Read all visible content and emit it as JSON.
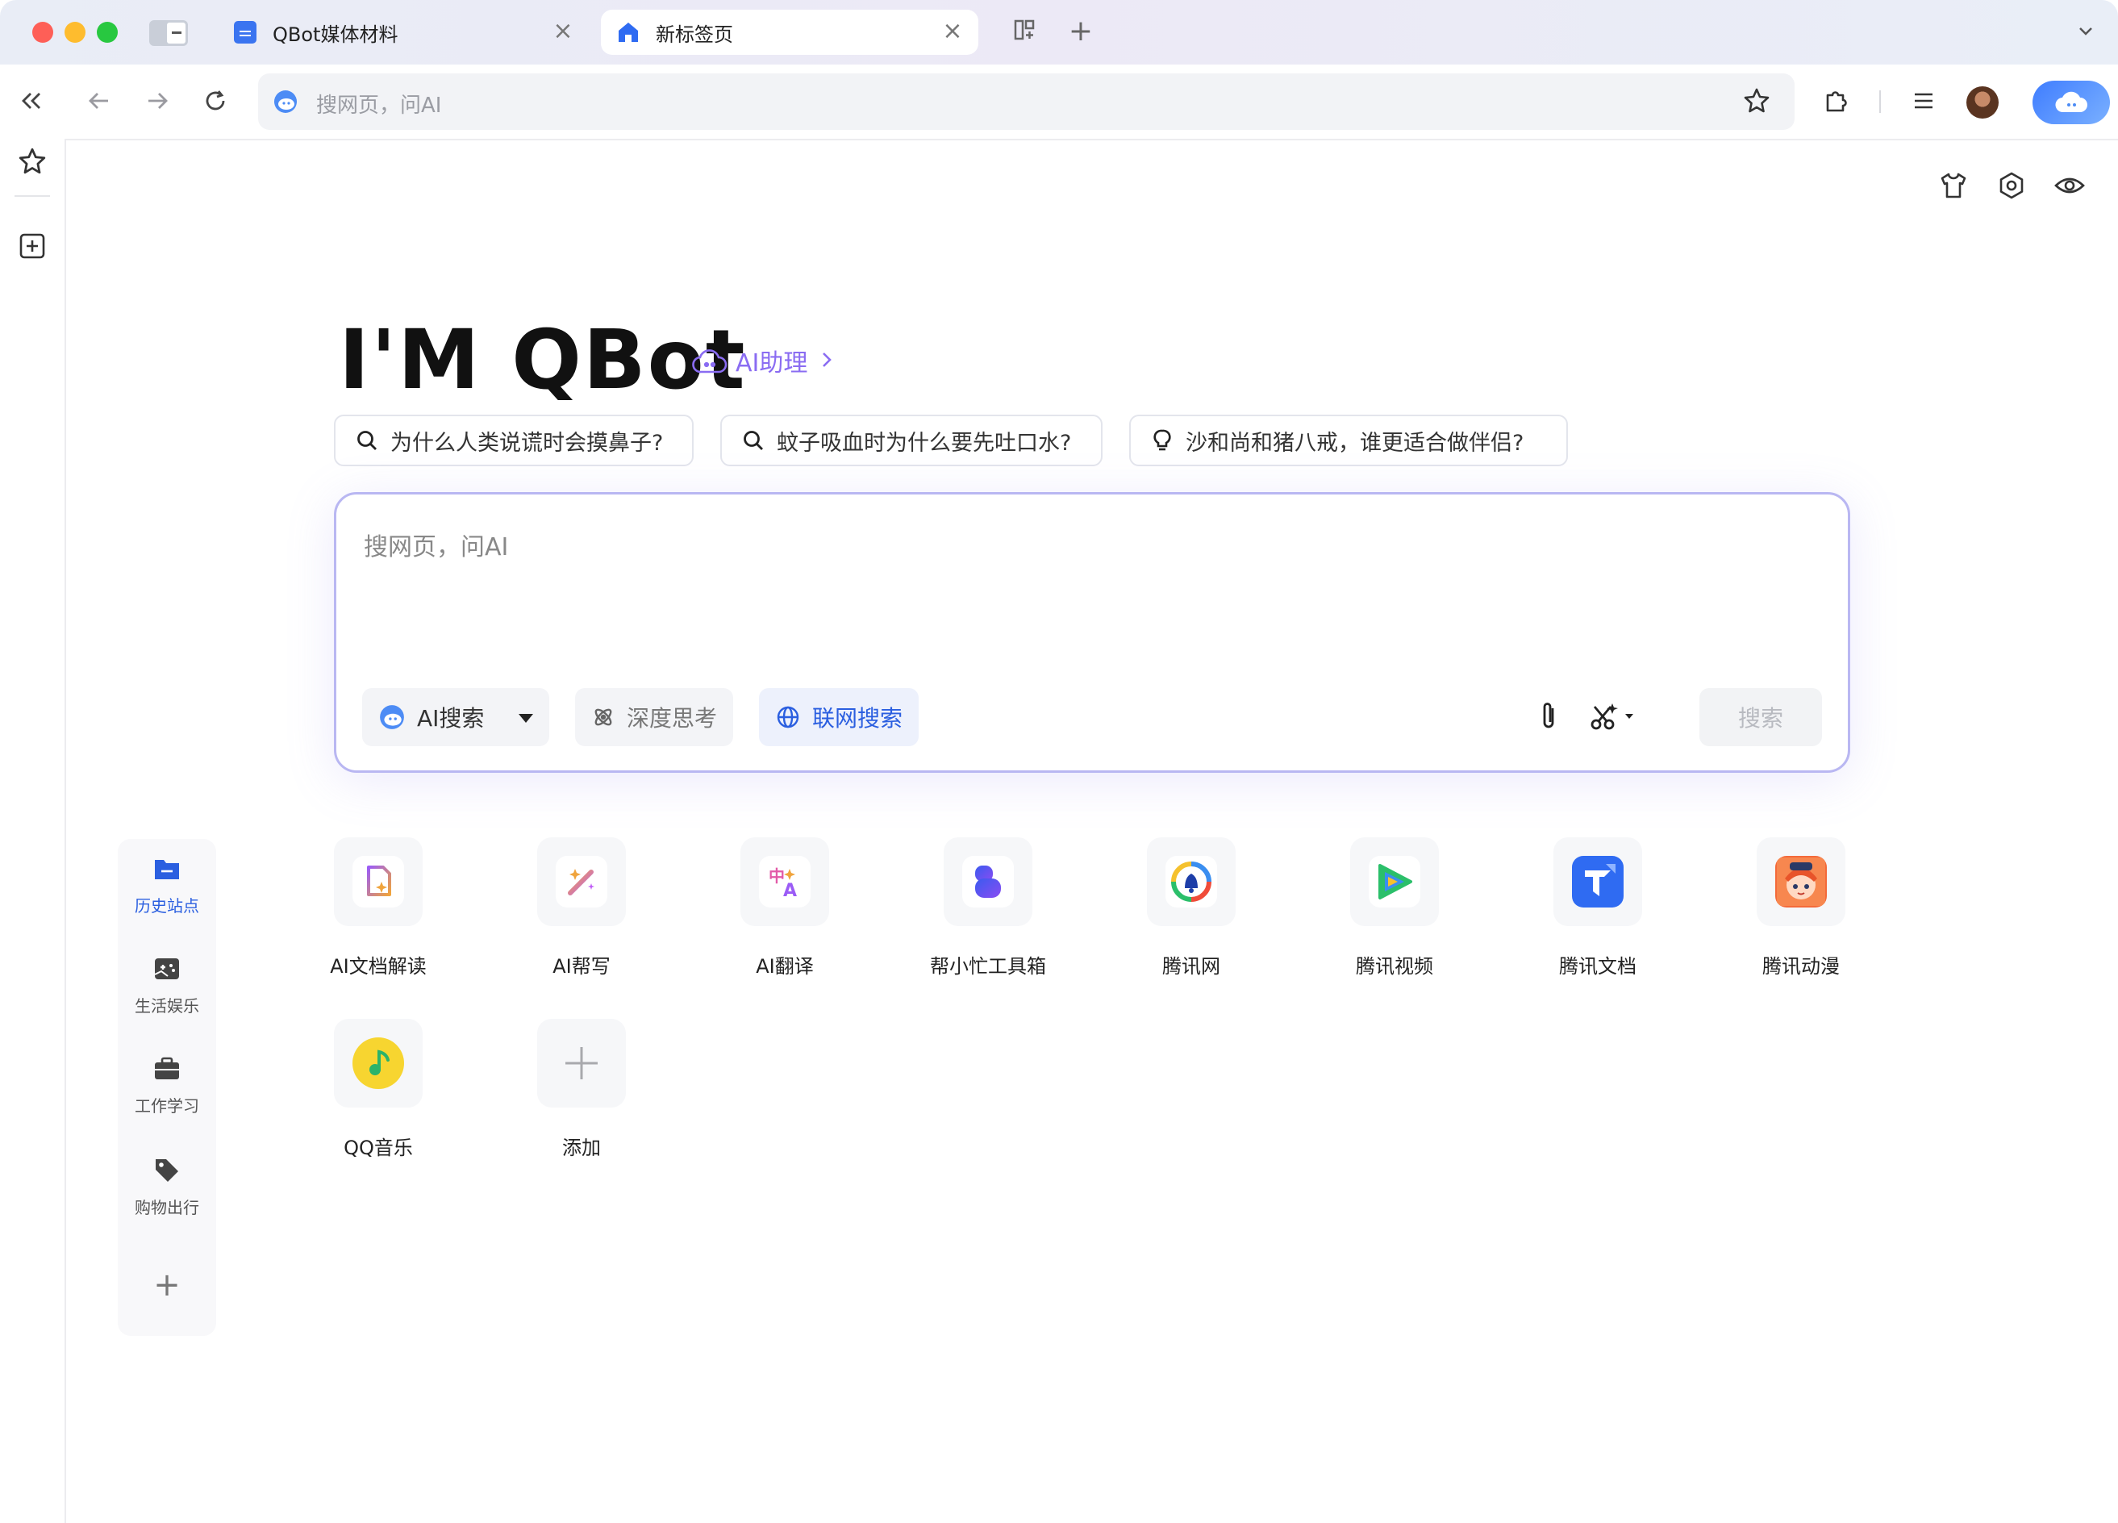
{
  "tabs": [
    {
      "label": "QBot媒体材料",
      "icon": "doc-icon",
      "active": false
    },
    {
      "label": "新标签页",
      "icon": "home-icon",
      "active": true
    }
  ],
  "omnibox": {
    "placeholder": "搜网页，问AI"
  },
  "hero": {
    "title": "I'M QBot",
    "assist_label": "AI助理"
  },
  "suggestions": [
    {
      "text": "为什么人类说谎时会摸鼻子?",
      "icon": "search-icon"
    },
    {
      "text": "蚊子吸血时为什么要先吐口水?",
      "icon": "search-icon"
    },
    {
      "text": "沙和尚和猪八戒，谁更适合做伴侣?",
      "icon": "lightbulb-icon"
    }
  ],
  "search": {
    "placeholder": "搜网页，问AI",
    "mode_label": "AI搜索",
    "deep_label": "深度思考",
    "web_label": "联网搜索",
    "submit_label": "搜索"
  },
  "categories": [
    {
      "label": "历史站点",
      "icon": "folder-icon",
      "active": true
    },
    {
      "label": "生活娱乐",
      "icon": "gamepad-icon",
      "active": false
    },
    {
      "label": "工作学习",
      "icon": "briefcase-icon",
      "active": false
    },
    {
      "label": "购物出行",
      "icon": "tag-icon",
      "active": false
    }
  ],
  "apps": [
    {
      "label": "AI文档解读",
      "icon": "ai-doc-icon"
    },
    {
      "label": "AI帮写",
      "icon": "ai-write-icon"
    },
    {
      "label": "AI翻译",
      "icon": "ai-translate-icon"
    },
    {
      "label": "帮小忙工具箱",
      "icon": "toolbox-icon"
    },
    {
      "label": "腾讯网",
      "icon": "tencent-news-icon"
    },
    {
      "label": "腾讯视频",
      "icon": "tencent-video-icon"
    },
    {
      "label": "腾讯文档",
      "icon": "tencent-docs-icon"
    },
    {
      "label": "腾讯动漫",
      "icon": "tencent-comic-icon"
    },
    {
      "label": "QQ音乐",
      "icon": "qq-music-icon"
    },
    {
      "label": "添加",
      "icon": "plus-icon"
    }
  ],
  "colors": {
    "accent": "#2b5fe0",
    "assist": "#8a6cf2",
    "search_border": "#b9b7f2"
  }
}
